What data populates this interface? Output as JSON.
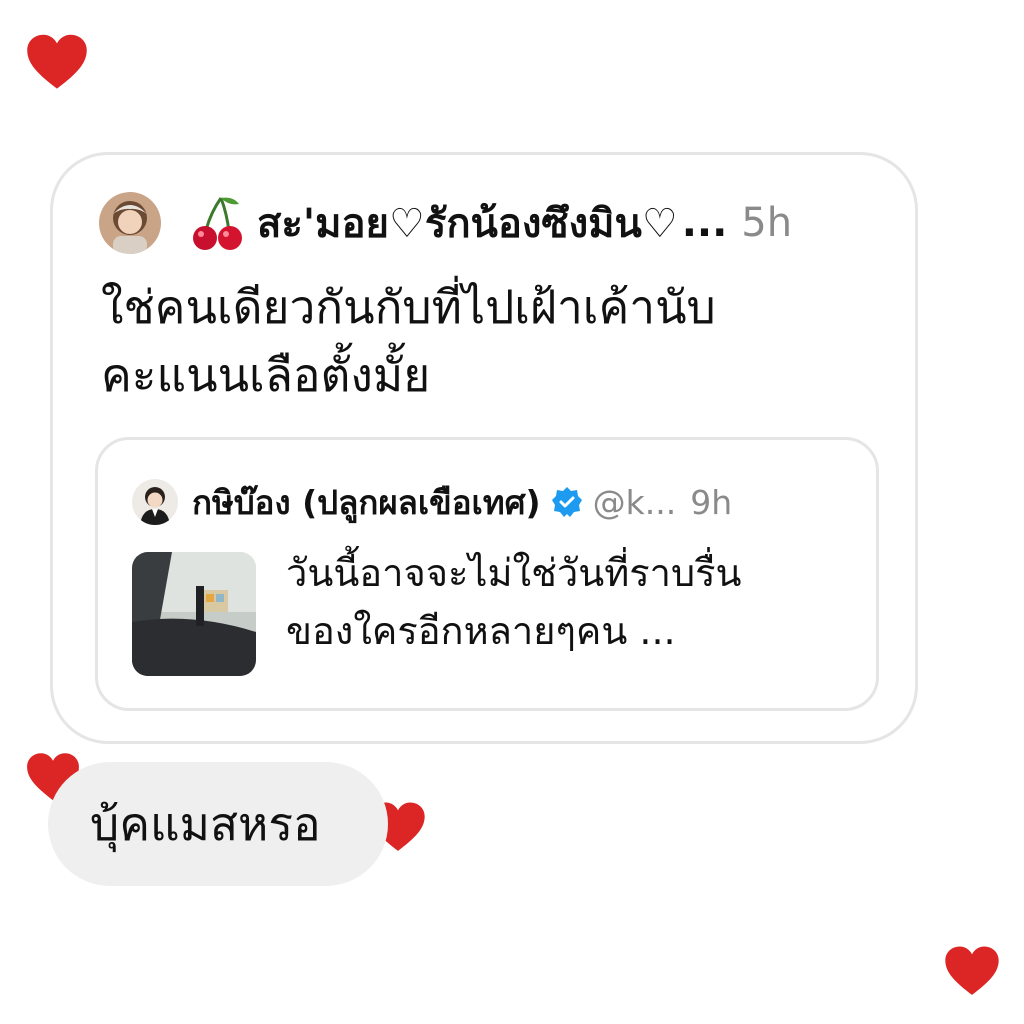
{
  "colors": {
    "heart": "#dc2626",
    "card_border": "#e5e5e5",
    "muted_text": "#8a8a8a",
    "bubble_bg": "#efefef",
    "verified": "#1d9bf0"
  },
  "quote_post": {
    "author_emoji": "cherries-icon",
    "author_name": "สะ'มอย♡รักน้องซึงมิน♡",
    "truncation": "...",
    "time": "5h",
    "text_line1": "ใช่คนเดียวกันกับที่ไปเฝ้าเค้านับ",
    "text_line2": "คะแนนเลือตั้งมั้ย"
  },
  "quoted_post": {
    "author_name": "กษิบ๊อง (ปลูกผลเขือเทศ)",
    "verified": true,
    "handle": "@k...",
    "time": "9h",
    "text_line1": "วันนี้อาจจะไม่ใช่วันที่ราบรื่น",
    "text_line2": "ของใครอีกหลายๆคน ..."
  },
  "reply": {
    "text": "บุ้คแมสหรอ"
  }
}
